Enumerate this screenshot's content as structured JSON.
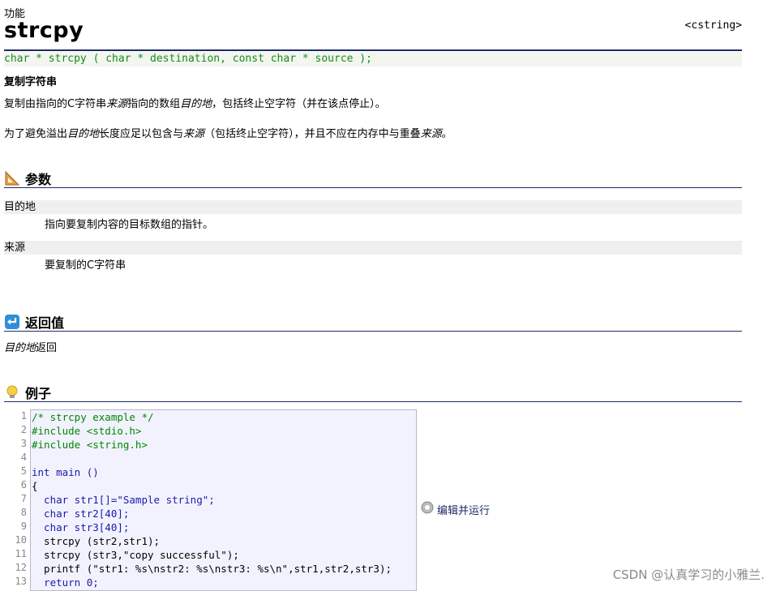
{
  "doc": {
    "kind": "功能",
    "name": "strcpy",
    "header": "<cstring>",
    "prototype": "char * strcpy ( char * destination, const char * source );",
    "summary": "复制字符串",
    "desc1_a": "复制由指向的C字符串",
    "desc1_i1": "来源",
    "desc1_b": "指向的数组",
    "desc1_i2": "目的地",
    "desc1_c": "，包括终止空字符（并在该点停止）。",
    "desc2_a": "为了避免溢出",
    "desc2_i1": "目的地",
    "desc2_b": "长度应足以包含与",
    "desc2_i2": "来源",
    "desc2_c": "（包括终止空字符），并且不应在内存中与重叠",
    "desc2_i3": "来源",
    "desc2_d": "。"
  },
  "sections": {
    "params": "参数",
    "returns": "返回值",
    "example": "例子"
  },
  "params": [
    {
      "term": "目的地",
      "desc": "指向要复制内容的目标数组的指针。"
    },
    {
      "term": "来源",
      "desc": "要复制的C字符串"
    }
  ],
  "returns": {
    "italic": "目的地",
    "text": "返回"
  },
  "example": {
    "line_numbers": [
      "1",
      "2",
      "3",
      "4",
      "5",
      "6",
      "7",
      "8",
      "9",
      "10",
      "11",
      "12",
      "13"
    ],
    "lines": [
      "/* strcpy example */",
      "#include <stdio.h>",
      "#include <string.h>",
      "",
      "int main ()",
      "{",
      "  char str1[]=\"Sample string\";",
      "  char str2[40];",
      "  char str3[40];",
      "  strcpy (str2,str1);",
      "  strcpy (str3,\"copy successful\");",
      "  printf (\"str1: %s\\nstr2: %s\\nstr3: %s\\n\",str1,str2,str3);",
      "  return 0;"
    ],
    "run_label": "编辑并运行"
  },
  "watermark": "CSDN @认真学习的小雅兰.",
  "colors": {
    "rule": "#1d2b66",
    "comment": "#008800",
    "keyword": "#1a1aaa",
    "string": "#a31515"
  },
  "icons": {
    "params": "ruler-triangle-icon",
    "returns": "return-arrow-icon",
    "example": "lightbulb-icon",
    "run": "gear-icon"
  }
}
